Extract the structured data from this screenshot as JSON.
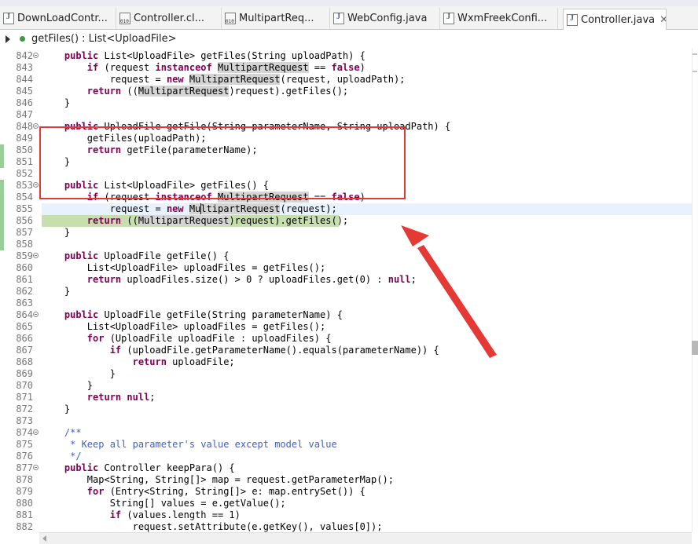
{
  "tabs": [
    {
      "label": "DownLoadContr...",
      "icon": "java-file-icon",
      "active": false
    },
    {
      "label": "Controller.cl...",
      "icon": "class-file-icon",
      "active": false
    },
    {
      "label": "MultipartReq...",
      "icon": "class-file-icon",
      "active": false
    },
    {
      "label": "WebConfig.java",
      "icon": "java-file-icon",
      "active": false
    },
    {
      "label": "WxmFreekConfi...",
      "icon": "java-file-icon",
      "active": false
    },
    {
      "label": "Controller.java",
      "icon": "java-file-icon",
      "active": true,
      "close": "✕"
    }
  ],
  "breadcrumb": {
    "label": "getFiles() : List<UploadFile>",
    "icon": "public-method-icon"
  },
  "colors": {
    "keyword": "#7f0055",
    "comment": "#3f5fbf",
    "highlight": "#c7dfae",
    "annotation": "#e53935"
  },
  "lines": [
    {
      "n": "842",
      "fold": true,
      "code": "    public List<UploadFile> getFiles(String uploadPath) {"
    },
    {
      "n": "843",
      "fold": false,
      "code": "        if (request instanceof MultipartRequest == false)"
    },
    {
      "n": "844",
      "fold": false,
      "code": "            request = new MultipartRequest(request, uploadPath);"
    },
    {
      "n": "845",
      "fold": false,
      "code": "        return ((MultipartRequest)request).getFiles();"
    },
    {
      "n": "846",
      "fold": false,
      "code": "    }"
    },
    {
      "n": "847",
      "fold": false,
      "code": ""
    },
    {
      "n": "848",
      "fold": true,
      "code": "    public UploadFile getFile(String parameterName, String uploadPath) {"
    },
    {
      "n": "849",
      "fold": false,
      "code": "        getFiles(uploadPath);"
    },
    {
      "n": "850",
      "fold": false,
      "code": "        return getFile(parameterName);"
    },
    {
      "n": "851",
      "fold": false,
      "code": "    }"
    },
    {
      "n": "852",
      "fold": false,
      "code": ""
    },
    {
      "n": "853",
      "fold": true,
      "code": "    public List<UploadFile> getFiles() {"
    },
    {
      "n": "854",
      "fold": false,
      "code": "        if (request instanceof MultipartRequest == false)"
    },
    {
      "n": "855",
      "fold": false,
      "code": "            request = new MultipartRequest(request);"
    },
    {
      "n": "856",
      "fold": false,
      "code": "        return ((MultipartRequest)request).getFiles();"
    },
    {
      "n": "857",
      "fold": false,
      "code": "    }"
    },
    {
      "n": "858",
      "fold": false,
      "code": ""
    },
    {
      "n": "859",
      "fold": true,
      "code": "    public UploadFile getFile() {"
    },
    {
      "n": "860",
      "fold": false,
      "code": "        List<UploadFile> uploadFiles = getFiles();"
    },
    {
      "n": "861",
      "fold": false,
      "code": "        return uploadFiles.size() > 0 ? uploadFiles.get(0) : null;"
    },
    {
      "n": "862",
      "fold": false,
      "code": "    }"
    },
    {
      "n": "863",
      "fold": false,
      "code": ""
    },
    {
      "n": "864",
      "fold": true,
      "code": "    public UploadFile getFile(String parameterName) {"
    },
    {
      "n": "865",
      "fold": false,
      "code": "        List<UploadFile> uploadFiles = getFiles();"
    },
    {
      "n": "866",
      "fold": false,
      "code": "        for (UploadFile uploadFile : uploadFiles) {"
    },
    {
      "n": "867",
      "fold": false,
      "code": "            if (uploadFile.getParameterName().equals(parameterName)) {"
    },
    {
      "n": "868",
      "fold": false,
      "code": "                return uploadFile;"
    },
    {
      "n": "869",
      "fold": false,
      "code": "            }"
    },
    {
      "n": "870",
      "fold": false,
      "code": "        }"
    },
    {
      "n": "871",
      "fold": false,
      "code": "        return null;"
    },
    {
      "n": "872",
      "fold": false,
      "code": "    }"
    },
    {
      "n": "873",
      "fold": false,
      "code": ""
    },
    {
      "n": "874",
      "fold": true,
      "code": "    /**"
    },
    {
      "n": "875",
      "fold": false,
      "code": "     * Keep all parameter's value except model value"
    },
    {
      "n": "876",
      "fold": false,
      "code": "     */"
    },
    {
      "n": "877",
      "fold": true,
      "code": "    public Controller keepPara() {"
    },
    {
      "n": "878",
      "fold": false,
      "code": "        Map<String, String[]> map = request.getParameterMap();"
    },
    {
      "n": "879",
      "fold": false,
      "code": "        for (Entry<String, String[]> e: map.entrySet()) {"
    },
    {
      "n": "880",
      "fold": false,
      "code": "            String[] values = e.getValue();"
    },
    {
      "n": "881",
      "fold": false,
      "code": "            if (values.length == 1)"
    },
    {
      "n": "882",
      "fold": false,
      "code": "                request.setAttribute(e.getKey(), values[0]);"
    }
  ]
}
